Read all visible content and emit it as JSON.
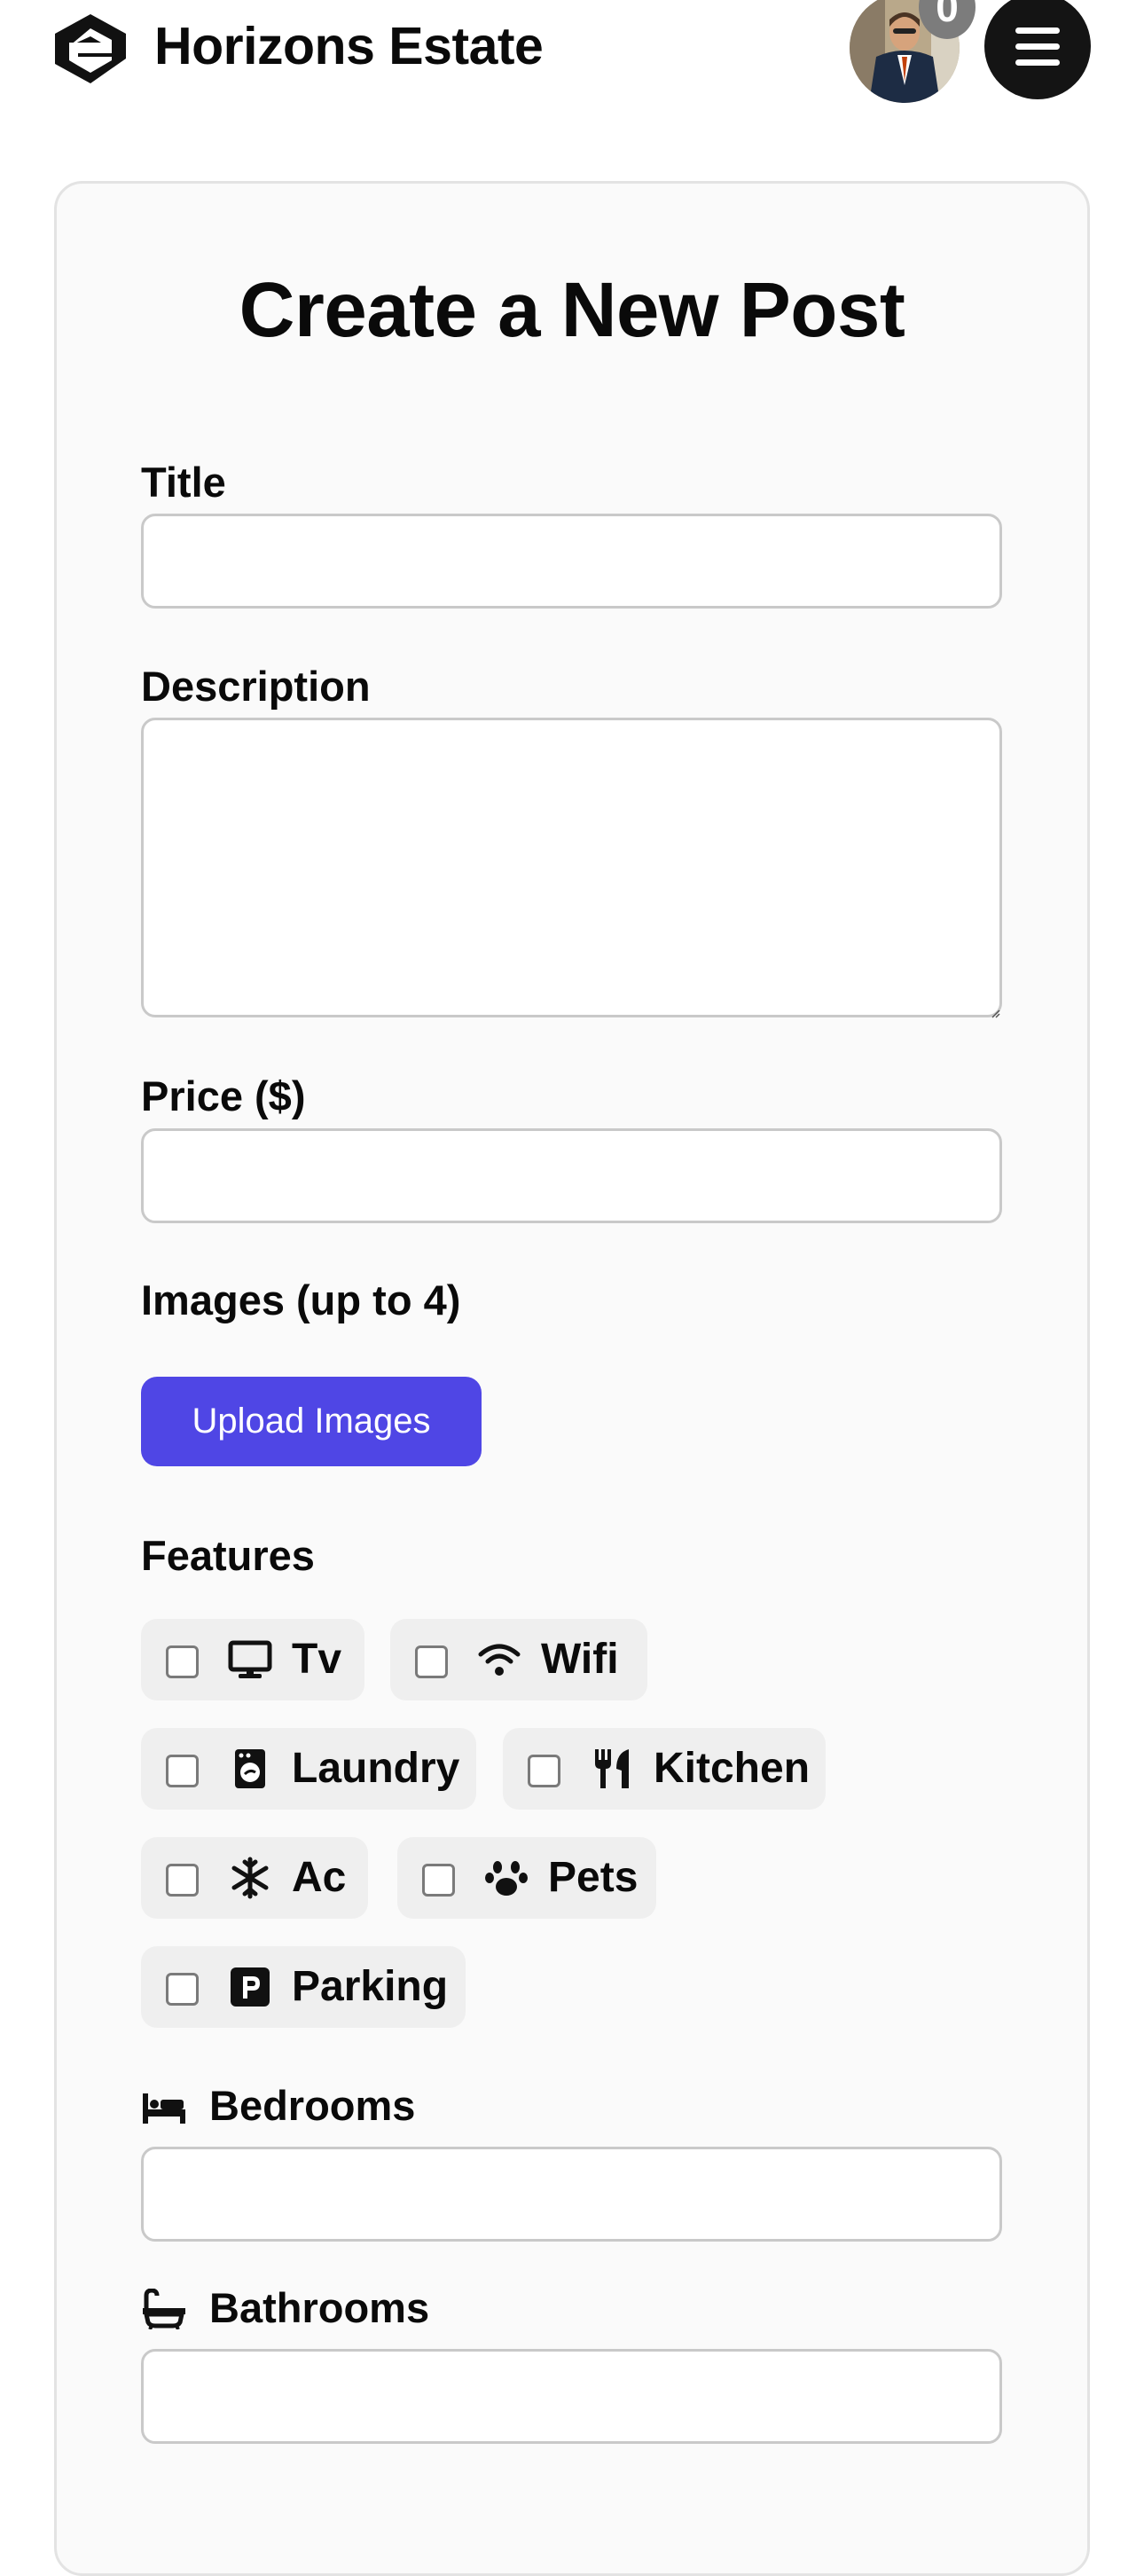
{
  "header": {
    "brand": "Horizons Estate",
    "notification_count": "0",
    "logo_icon": "horizons-logo",
    "menu_icon": "hamburger-menu-icon"
  },
  "form": {
    "title": "Create a New Post",
    "fields": {
      "title_label": "Title",
      "title_value": "",
      "description_label": "Description",
      "description_value": "",
      "price_label": "Price ($)",
      "price_value": "",
      "images_label": "Images (up to 4)",
      "upload_button": "Upload Images",
      "features_label": "Features",
      "bedrooms_label": "Bedrooms",
      "bedrooms_value": "",
      "bathrooms_label": "Bathrooms",
      "bathrooms_value": ""
    },
    "features": [
      {
        "label": "Tv",
        "icon": "tv-icon",
        "checked": false
      },
      {
        "label": "Wifi",
        "icon": "wifi-icon",
        "checked": false
      },
      {
        "label": "Laundry",
        "icon": "washing-machine-icon",
        "checked": false
      },
      {
        "label": "Kitchen",
        "icon": "utensils-icon",
        "checked": false
      },
      {
        "label": "Ac",
        "icon": "snowflake-icon",
        "checked": false
      },
      {
        "label": "Pets",
        "icon": "paw-icon",
        "checked": false
      },
      {
        "label": "Parking",
        "icon": "parking-icon",
        "checked": false
      }
    ]
  },
  "colors": {
    "accent": "#4f46e5",
    "text": "#0a0a0a",
    "card_background": "#fafafa",
    "chip_background": "#efefef",
    "menu_button": "#141414",
    "badge": "#7c7c7c"
  }
}
